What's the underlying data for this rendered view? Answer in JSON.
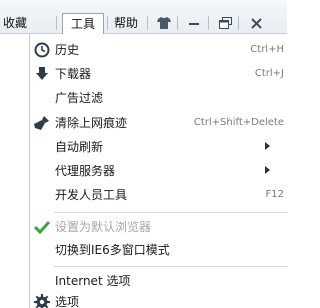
{
  "menubar": {
    "favorites_label": "收藏",
    "tools_label": "工具",
    "help_label": "帮助"
  },
  "window_controls": {
    "skin_icon": "shirt-icon",
    "minimize_icon": "minimize-icon",
    "restore_icon": "restore-icon",
    "close_icon": "close-icon"
  },
  "tools_menu": {
    "items": [
      {
        "label": "历史",
        "shortcut": "Ctrl+H",
        "icon": "clock-icon"
      },
      {
        "label": "下载器",
        "shortcut": "Ctrl+J",
        "icon": "download-arrow-icon"
      },
      {
        "label": "广告过滤",
        "shortcut": "",
        "icon": ""
      },
      {
        "label": "清除上网痕迹",
        "shortcut": "Ctrl+Shift+Delete",
        "icon": "broom-icon"
      },
      {
        "label": "自动刷新",
        "shortcut": "",
        "icon": "",
        "submenu": true
      },
      {
        "label": "代理服务器",
        "shortcut": "",
        "icon": "",
        "submenu": true
      },
      {
        "label": "开发人员工具",
        "shortcut": "F12",
        "icon": ""
      },
      {
        "label": "设置为默认浏览器",
        "shortcut": "",
        "icon": "checkmark-icon",
        "disabled": true
      },
      {
        "label": "切换到IE6多窗口模式",
        "shortcut": "",
        "icon": ""
      },
      {
        "label": "Internet 选项",
        "shortcut": "",
        "icon": ""
      },
      {
        "label": "选项",
        "shortcut": "",
        "icon": "gear-icon"
      }
    ]
  },
  "colors": {
    "check_green": "#3aa640",
    "icon_dark": "#2f3b48"
  }
}
